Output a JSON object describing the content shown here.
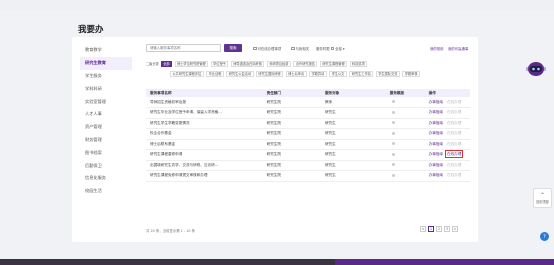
{
  "page_title": "我要办",
  "sidebar": {
    "items": [
      {
        "label": "教育教学"
      },
      {
        "label": "研究生教育",
        "active": true
      },
      {
        "label": "学生服务"
      },
      {
        "label": "学科科研"
      },
      {
        "label": "实验室管理"
      },
      {
        "label": "人才人事"
      },
      {
        "label": "资产管理"
      },
      {
        "label": "财务管理"
      },
      {
        "label": "图书档案"
      },
      {
        "label": "后勤保卫"
      },
      {
        "label": "信息化服务"
      },
      {
        "label": "校园生活"
      }
    ]
  },
  "search": {
    "placeholder": "请输入服务事项名称",
    "button_label": "搜索"
  },
  "options": {
    "online_only": "可在线办理事项",
    "my_favorites": "与我相关",
    "sort_label": "服务时限",
    "sort_value": "全部",
    "link_common": "我的常用",
    "link_favorites": "我的可赢通事"
  },
  "filter": {
    "label": "二级分类",
    "row1": [
      "全部",
      "博士学位研究院管理",
      "学位授予",
      "博导遴选及在岗考核",
      "科研项目经费",
      "合作研究报告",
      "研究生课程管理",
      "科技奖项"
    ],
    "row2": [
      "公共研究生课程评估",
      "毕业证明",
      "研究生公益活动",
      "研究生国际研修",
      "博士后申请",
      "学籍异动",
      "学生公文",
      "研究生工作站",
      "学生国际交流",
      "学籍审核"
    ]
  },
  "table": {
    "headers": [
      "服务事项名称",
      "责任部门",
      "服务对象",
      "服务模版",
      "操作"
    ],
    "rows": [
      {
        "name": "导师招生资格初审及报",
        "dept": "研究生院",
        "target": "教师",
        "ops": [
          "办事指南",
          "在线办理"
        ],
        "online_enabled": false
      },
      {
        "name": "研究生毕业及学位授予申请、保留入学资格...",
        "dept": "研究生院",
        "target": "研究生",
        "ops": [
          "办事指南",
          "在线办理"
        ],
        "online_enabled": false
      },
      {
        "name": "研究生学生学籍变更情况",
        "dept": "研究生院",
        "target": "研究生",
        "ops": [
          "办事指南",
          "在线办理"
        ],
        "online_enabled": false
      },
      {
        "name": "校企合作基金",
        "dept": "研究生院",
        "target": "研究生",
        "ops": [
          "办事指南",
          "在线办理"
        ],
        "online_enabled": false
      },
      {
        "name": "博士后联系基金",
        "dept": "研究生院",
        "target": "研究生",
        "ops": [
          "办事指南",
          "在线办理"
        ],
        "online_enabled": false
      },
      {
        "name": "研究生课程重修申请",
        "dept": "研究生院",
        "target": "研究生",
        "ops": [
          "办事指南",
          "在线办理"
        ],
        "online_enabled": true,
        "highlight": true
      },
      {
        "name": "出国境研究生访学、交流与研修、互访研...",
        "dept": "研究生院",
        "target": "研究生",
        "ops": [
          "办事指南",
          "在线办理"
        ],
        "online_enabled": false
      },
      {
        "name": "研究生课程免修申请提交审核和办理",
        "dept": "研究生院",
        "target": "研究生",
        "ops": [
          "办事指南",
          "在线办理"
        ],
        "online_enabled": false
      }
    ]
  },
  "pagination": {
    "summary": "共 20 条，当前显示第 1 - 10 条",
    "pages": [
      "<",
      "1",
      "2",
      "3",
      ">"
    ],
    "current": "1"
  },
  "side_widget": {
    "label": "回到顶部"
  },
  "help_icon": "?",
  "colors": {
    "accent": "#5d2d92",
    "highlight": "#e03030"
  }
}
